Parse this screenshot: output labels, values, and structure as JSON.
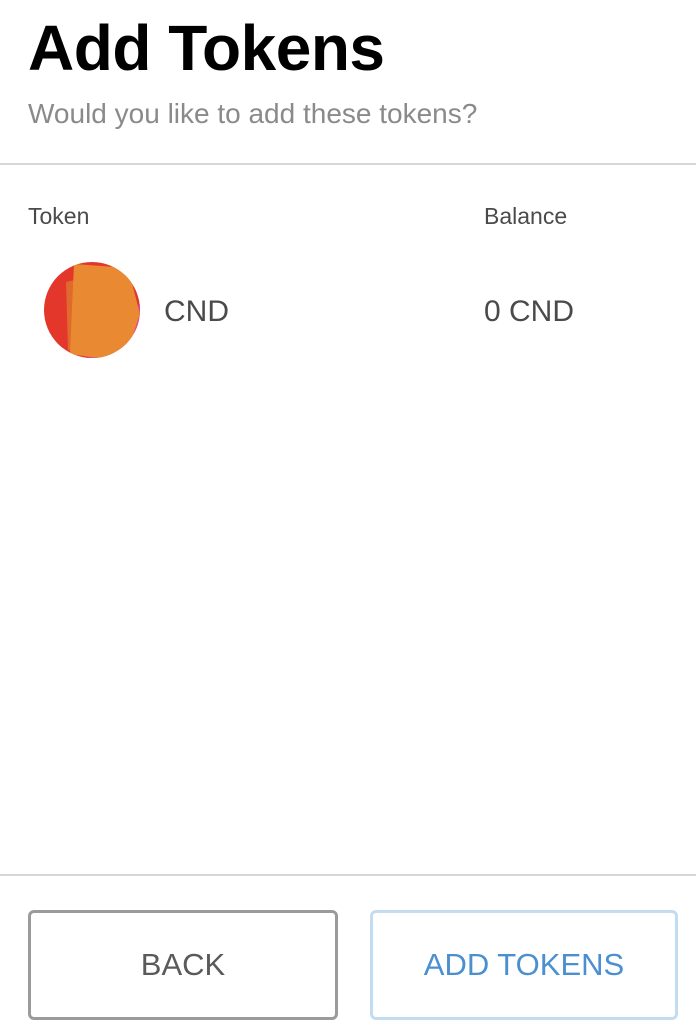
{
  "header": {
    "title": "Add Tokens",
    "subtitle": "Would you like to add these tokens?"
  },
  "table": {
    "columns": [
      "Token",
      "Balance"
    ],
    "rows": [
      {
        "icon": "token-identicon",
        "symbol": "CND",
        "balance": "0 CND"
      }
    ]
  },
  "footer": {
    "back_label": "BACK",
    "add_label": "ADD TOKENS"
  },
  "colors": {
    "accent": "#4a90d0",
    "divider": "#d6d6d6",
    "subtitle": "#8a8a8a"
  }
}
